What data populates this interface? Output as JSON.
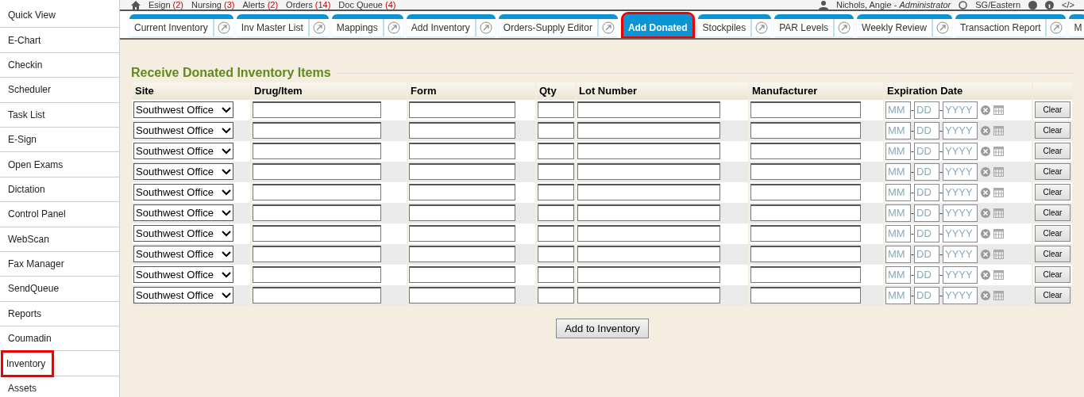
{
  "top_bar": {
    "links": [
      {
        "label": "Esign",
        "count": "(2)"
      },
      {
        "label": "Nursing",
        "count": "(3)"
      },
      {
        "label": "Alerts",
        "count": "(2)"
      },
      {
        "label": "Orders",
        "count": "(14)"
      },
      {
        "label": "Doc Queue",
        "count": "(4)"
      }
    ],
    "user": "Nichols, Angie - *Administrator*",
    "timezone": "SG/Eastern",
    "code_link": "</>"
  },
  "sidebar": {
    "items": [
      {
        "label": "Quick View",
        "selected": false
      },
      {
        "label": "E-Chart",
        "selected": false
      },
      {
        "label": "Checkin",
        "selected": false
      },
      {
        "label": "Scheduler",
        "selected": false
      },
      {
        "label": "Task List",
        "selected": false
      },
      {
        "label": "E-Sign",
        "selected": false
      },
      {
        "label": "Open Exams",
        "selected": false
      },
      {
        "label": "Dictation",
        "selected": false
      },
      {
        "label": "Control Panel",
        "selected": false
      },
      {
        "label": "WebScan",
        "selected": false
      },
      {
        "label": "Fax Manager",
        "selected": false
      },
      {
        "label": "SendQueue",
        "selected": false
      },
      {
        "label": "Reports",
        "selected": false
      },
      {
        "label": "Coumadin",
        "selected": false
      },
      {
        "label": "Inventory",
        "selected": true
      },
      {
        "label": "Assets",
        "selected": false
      }
    ]
  },
  "tabs": [
    {
      "label": "Current Inventory",
      "selected": false
    },
    {
      "label": "Inv Master List",
      "selected": false
    },
    {
      "label": "Mappings",
      "selected": false
    },
    {
      "label": "Add Inventory",
      "selected": false
    },
    {
      "label": "Orders-Supply Editor",
      "selected": false
    },
    {
      "label": "Add Donated",
      "selected": true
    },
    {
      "label": "Stockpiles",
      "selected": false
    },
    {
      "label": "PAR Levels",
      "selected": false
    },
    {
      "label": "Weekly Review",
      "selected": false
    },
    {
      "label": "Transaction Report",
      "selected": false
    },
    {
      "label": "M",
      "selected": false
    }
  ],
  "form": {
    "title": "Receive Donated Inventory Items",
    "columns": [
      "Site",
      "Drug/Item",
      "Form",
      "Qty",
      "Lot Number",
      "Manufacturer",
      "Expiration Date"
    ],
    "rows": [
      {
        "site": "Southwest Office",
        "month": {
          "placeholder": "MM"
        },
        "separator_1": "-",
        "day": {
          "placeholder": "DD"
        },
        "separator_2": "-",
        "year": {
          "placeholder": "YYYY"
        },
        "clear": "Clear"
      },
      {
        "site": "Southwest Office",
        "month": {
          "placeholder": "MM"
        },
        "separator_1": "-",
        "day": {
          "placeholder": "DD"
        },
        "separator_2": "-",
        "year": {
          "placeholder": "YYYY"
        },
        "clear": "Clear"
      },
      {
        "site": "Southwest Office",
        "month": {
          "placeholder": "MM"
        },
        "separator_1": "-",
        "day": {
          "placeholder": "DD"
        },
        "separator_2": "-",
        "year": {
          "placeholder": "YYYY"
        },
        "clear": "Clear"
      },
      {
        "site": "Southwest Office",
        "month": {
          "placeholder": "MM"
        },
        "separator_1": "-",
        "day": {
          "placeholder": "DD"
        },
        "separator_2": "-",
        "year": {
          "placeholder": "YYYY"
        },
        "clear": "Clear"
      },
      {
        "site": "Southwest Office",
        "month": {
          "placeholder": "MM"
        },
        "separator_1": "-",
        "day": {
          "placeholder": "DD"
        },
        "separator_2": "-",
        "year": {
          "placeholder": "YYYY"
        },
        "clear": "Clear"
      },
      {
        "site": "Southwest Office",
        "month": {
          "placeholder": "MM"
        },
        "separator_1": "-",
        "day": {
          "placeholder": "DD"
        },
        "separator_2": "-",
        "year": {
          "placeholder": "YYYY"
        },
        "clear": "Clear"
      },
      {
        "site": "Southwest Office",
        "month": {
          "placeholder": "MM"
        },
        "separator_1": "-",
        "day": {
          "placeholder": "DD"
        },
        "separator_2": "-",
        "year": {
          "placeholder": "YYYY"
        },
        "clear": "Clear"
      },
      {
        "site": "Southwest Office",
        "month": {
          "placeholder": "MM"
        },
        "separator_1": "-",
        "day": {
          "placeholder": "DD"
        },
        "separator_2": "-",
        "year": {
          "placeholder": "YYYY"
        },
        "clear": "Clear"
      },
      {
        "site": "Southwest Office",
        "month": {
          "placeholder": "MM"
        },
        "separator_1": "-",
        "day": {
          "placeholder": "DD"
        },
        "separator_2": "-",
        "year": {
          "placeholder": "YYYY"
        },
        "clear": "Clear"
      },
      {
        "site": "Southwest Office",
        "month": {
          "placeholder": "MM"
        },
        "separator_1": "-",
        "day": {
          "placeholder": "DD"
        },
        "separator_2": "-",
        "year": {
          "placeholder": "YYYY"
        },
        "clear": "Clear"
      }
    ],
    "submit": "Add to Inventory"
  }
}
